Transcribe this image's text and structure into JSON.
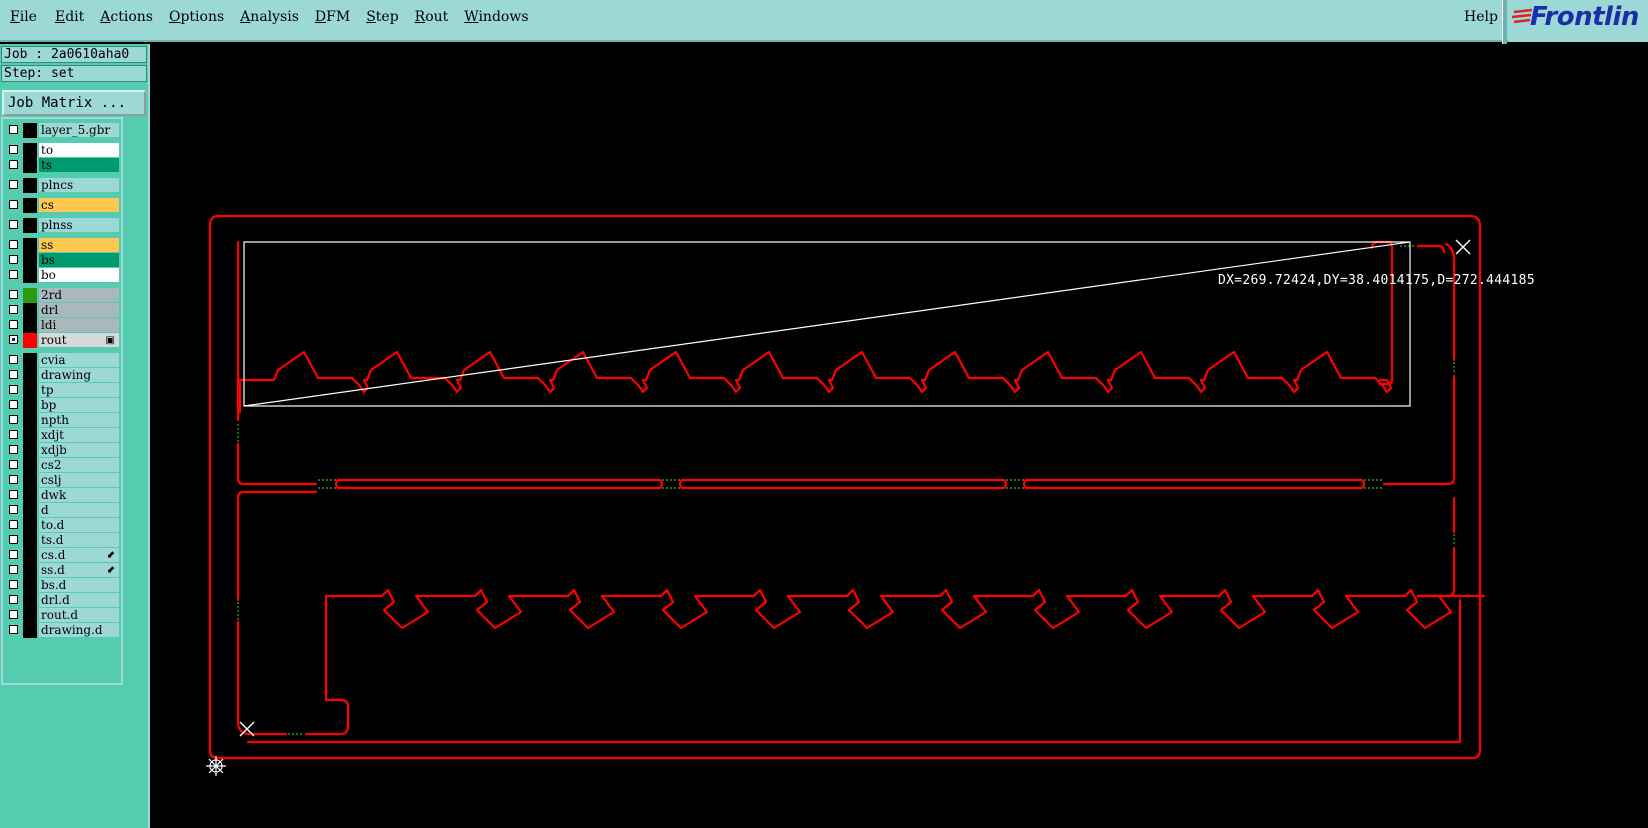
{
  "menubar": {
    "items": [
      {
        "label": "File"
      },
      {
        "label": "Edit"
      },
      {
        "label": "Actions"
      },
      {
        "label": "Options"
      },
      {
        "label": "Analysis"
      },
      {
        "label": "DFM"
      },
      {
        "label": "Step"
      },
      {
        "label": "Rout"
      },
      {
        "label": "Windows"
      }
    ],
    "help_label": "Help",
    "logo_text": "Frontlin"
  },
  "job": {
    "job_label": "Job : 2a0610aha0",
    "step_label": "Step: set",
    "matrix_button": "Job Matrix ..."
  },
  "layers": [
    {
      "name": "layer_5.gbr",
      "color": "#9bd8d6",
      "swatch": "#000000",
      "checked": false
    },
    {
      "name": "to",
      "color": "#ffffff",
      "swatch": "#000000",
      "checked": false
    },
    {
      "name": "ts",
      "color": "#009a70",
      "swatch": "#000000",
      "checked": false
    },
    {
      "name": "plncs",
      "color": "#9bd8d6",
      "swatch": "#000000",
      "checked": false
    },
    {
      "name": "cs",
      "color": "#ffc850",
      "swatch": "#000000",
      "checked": false
    },
    {
      "name": "plnss",
      "color": "#9bd8d6",
      "swatch": "#000000",
      "checked": false
    },
    {
      "name": "ss",
      "color": "#ffc850",
      "swatch": "#000000",
      "checked": false
    },
    {
      "name": "bs",
      "color": "#009a70",
      "swatch": "#000000",
      "checked": false
    },
    {
      "name": "bo",
      "color": "#ffffff",
      "swatch": "#000000",
      "checked": false
    },
    {
      "name": "2rd",
      "color": "#a8b8bc",
      "swatch": "#2e9a10",
      "checked": false
    },
    {
      "name": "drl",
      "color": "#a8b8bc",
      "swatch": "#000000",
      "checked": false
    },
    {
      "name": "ldi",
      "color": "#a8b8bc",
      "swatch": "#000000",
      "checked": false
    },
    {
      "name": "rout",
      "color": "#d8d8d8",
      "swatch": "#ff0000",
      "checked": true,
      "mark": "▣"
    },
    {
      "name": "cvia",
      "color": "#9bd8d6",
      "swatch": "#000000",
      "checked": false
    },
    {
      "name": "drawing",
      "color": "#9bd8d6",
      "swatch": "#000000",
      "checked": false
    },
    {
      "name": "tp",
      "color": "#9bd8d6",
      "swatch": "#000000",
      "checked": false
    },
    {
      "name": "bp",
      "color": "#9bd8d6",
      "swatch": "#000000",
      "checked": false
    },
    {
      "name": "npth",
      "color": "#9bd8d6",
      "swatch": "#000000",
      "checked": false
    },
    {
      "name": "xdjt",
      "color": "#9bd8d6",
      "swatch": "#000000",
      "checked": false
    },
    {
      "name": "xdjb",
      "color": "#9bd8d6",
      "swatch": "#000000",
      "checked": false
    },
    {
      "name": "cs2",
      "color": "#9bd8d6",
      "swatch": "#000000",
      "checked": false
    },
    {
      "name": "cslj",
      "color": "#9bd8d6",
      "swatch": "#000000",
      "checked": false
    },
    {
      "name": "dwk",
      "color": "#9bd8d6",
      "swatch": "#000000",
      "checked": false
    },
    {
      "name": "d",
      "color": "#9bd8d6",
      "swatch": "#000000",
      "checked": false
    },
    {
      "name": "to.d",
      "color": "#9bd8d6",
      "swatch": "#000000",
      "checked": false
    },
    {
      "name": "ts.d",
      "color": "#9bd8d6",
      "swatch": "#000000",
      "checked": false
    },
    {
      "name": "cs.d",
      "color": "#9bd8d6",
      "swatch": "#000000",
      "checked": false,
      "mark": "⬋"
    },
    {
      "name": "ss.d",
      "color": "#9bd8d6",
      "swatch": "#000000",
      "checked": false,
      "mark": "⬋"
    },
    {
      "name": "bs.d",
      "color": "#9bd8d6",
      "swatch": "#000000",
      "checked": false
    },
    {
      "name": "drl.d",
      "color": "#9bd8d6",
      "swatch": "#000000",
      "checked": false
    },
    {
      "name": "rout.d",
      "color": "#9bd8d6",
      "swatch": "#000000",
      "checked": false
    },
    {
      "name": "drawing.d",
      "color": "#9bd8d6",
      "swatch": "#000000",
      "checked": false
    }
  ],
  "canvas": {
    "measure_readout": "DX=269.72424,DY=38.4014175,D=272.444185",
    "rout_color": "#ff0000",
    "tab_color": "#2e9a10",
    "measure_color": "#ffffff"
  }
}
